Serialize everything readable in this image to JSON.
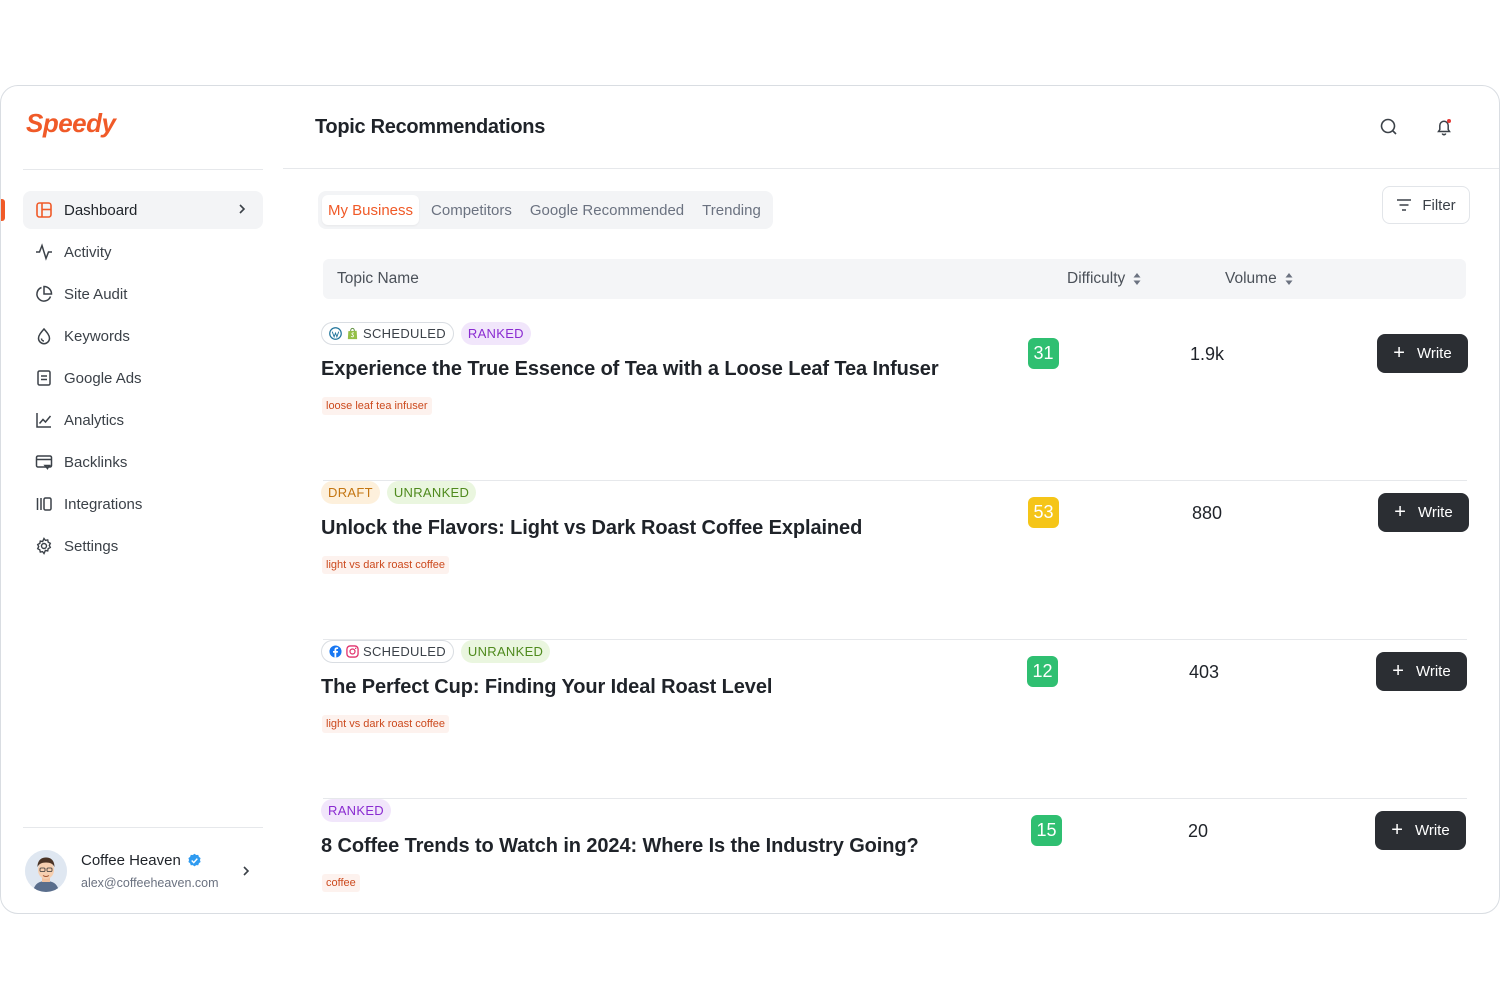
{
  "brand": {
    "name": "Speedy",
    "color": "#f05a28"
  },
  "sidebar": {
    "items": [
      {
        "label": "Dashboard",
        "icon": "layout-icon",
        "active": true
      },
      {
        "label": "Activity",
        "icon": "activity-icon"
      },
      {
        "label": "Site Audit",
        "icon": "pie-chart-icon"
      },
      {
        "label": "Keywords",
        "icon": "drop-icon"
      },
      {
        "label": "Google Ads",
        "icon": "document-icon"
      },
      {
        "label": "Analytics",
        "icon": "line-chart-icon"
      },
      {
        "label": "Backlinks",
        "icon": "browser-link-icon"
      },
      {
        "label": "Integrations",
        "icon": "columns-icon"
      },
      {
        "label": "Settings",
        "icon": "gear-icon"
      }
    ]
  },
  "user": {
    "name": "Coffee Heaven",
    "email": "alex@coffeeheaven.com",
    "verified": true
  },
  "header": {
    "title": "Topic Recommendations",
    "search_icon": "search-icon",
    "notification_icon": "bell-icon"
  },
  "tabs": [
    {
      "label": "My Business",
      "active": true
    },
    {
      "label": "Competitors"
    },
    {
      "label": "Google Recommended"
    },
    {
      "label": "Trending"
    }
  ],
  "filter": {
    "label": "Filter"
  },
  "table": {
    "headers": {
      "topic": "Topic Name",
      "difficulty": "Difficulty",
      "volume": "Volume"
    },
    "rows": [
      {
        "badges": [
          {
            "type": "scheduled",
            "label": "SCHEDULED",
            "platforms": [
              "wordpress",
              "shopify"
            ]
          },
          {
            "type": "ranked",
            "label": "RANKED"
          }
        ],
        "title": "Experience the True Essence of Tea with a Loose Leaf Tea Infuser",
        "keyword": "loose leaf tea infuser",
        "difficulty": "31",
        "difficulty_color": "#2fbf71",
        "volume": "1.9k",
        "action": "Write"
      },
      {
        "badges": [
          {
            "type": "draft",
            "label": "DRAFT"
          },
          {
            "type": "unranked",
            "label": "UNRANKED"
          }
        ],
        "title": "Unlock the Flavors: Light vs Dark Roast Coffee Explained",
        "keyword": "light vs dark roast coffee",
        "difficulty": "53",
        "difficulty_color": "#f5c518",
        "volume": "880",
        "action": "Write"
      },
      {
        "badges": [
          {
            "type": "scheduled",
            "label": "SCHEDULED",
            "platforms": [
              "facebook",
              "instagram"
            ]
          },
          {
            "type": "unranked",
            "label": "UNRANKED"
          }
        ],
        "title": "The Perfect Cup: Finding Your Ideal Roast Level",
        "keyword": "light vs dark roast coffee",
        "difficulty": "12",
        "difficulty_color": "#2fbf71",
        "volume": "403",
        "action": "Write"
      },
      {
        "badges": [
          {
            "type": "ranked",
            "label": "RANKED"
          }
        ],
        "title": "8 Coffee Trends to Watch in 2024: Where Is the Industry Going?",
        "keyword": "coffee",
        "difficulty": "15",
        "difficulty_color": "#2fbf71",
        "volume": "20",
        "action": "Write"
      }
    ]
  }
}
